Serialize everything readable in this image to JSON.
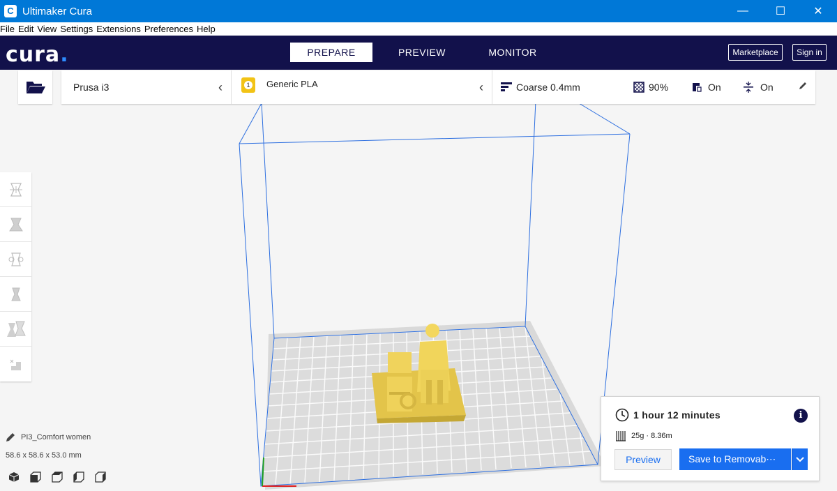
{
  "window": {
    "title": "Ultimaker Cura",
    "app_icon": "C",
    "minimize": "—",
    "maximize": "☐",
    "close": "✕"
  },
  "menu": [
    "File",
    "Edit",
    "View",
    "Settings",
    "Extensions",
    "Preferences",
    "Help"
  ],
  "header": {
    "logo": "cura",
    "tabs": [
      "PREPARE",
      "PREVIEW",
      "MONITOR"
    ],
    "marketplace": "Marketplace",
    "signin": "Sign in"
  },
  "stage": {
    "printer": "Prusa i3",
    "material_badge": "1",
    "material": "Generic PLA",
    "profile": "Coarse 0.4mm",
    "infill": "90%",
    "support": "On",
    "adhesion": "On",
    "chevron": "‹"
  },
  "object": {
    "name": "PI3_Comfort women",
    "dims": "58.6 x 58.6 x 53.0 mm"
  },
  "print": {
    "time": "1 hour 12 minutes",
    "info": "i",
    "material": "25g · 8.36m",
    "preview": "Preview",
    "save": "Save to Removab⋯"
  },
  "colors": {
    "header": "#12114b",
    "accent": "#196ef0",
    "model": "#f5d75a",
    "titlebar": "#0078d7"
  }
}
